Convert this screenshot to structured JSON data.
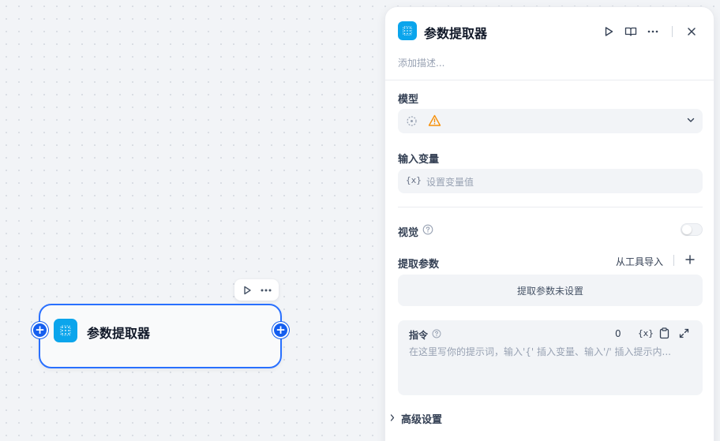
{
  "node": {
    "title": "参数提取器",
    "icon": "parameter-extractor-icon"
  },
  "panel": {
    "title": "参数提取器",
    "description_placeholder": "添加描述...",
    "model": {
      "label": "模型",
      "icon": "model-placeholder-icon",
      "warning_icon": "warning-triangle-icon"
    },
    "input_variable": {
      "label": "输入变量",
      "prefix": "{x}",
      "placeholder": "设置变量值"
    },
    "vision": {
      "label": "视觉",
      "enabled": false
    },
    "extract_params": {
      "label": "提取参数",
      "import_label": "从工具导入",
      "empty_text": "提取参数未设置"
    },
    "instruction": {
      "label": "指令",
      "count": "0",
      "var_label": "{x}",
      "placeholder": "在这里写你的提示词，输入'{' 插入变量、输入'/' 插入提示内..."
    },
    "advanced": {
      "label": "高级设置"
    }
  },
  "colors": {
    "accent": "#155eef",
    "node_icon_bg": "#0ba5ec",
    "warning": "#f79009"
  }
}
